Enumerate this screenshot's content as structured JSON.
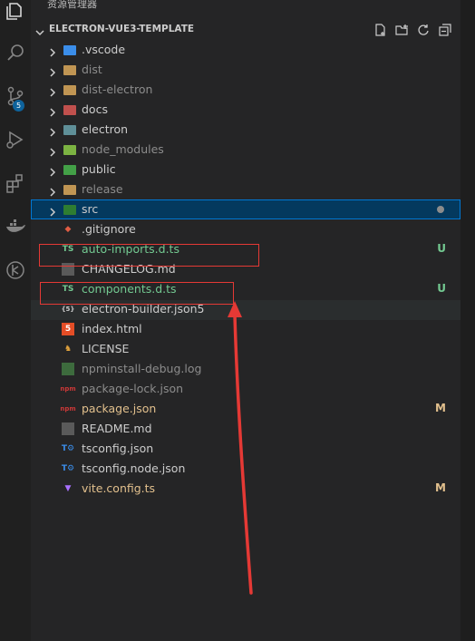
{
  "sidebar": {
    "title": "资源管理器",
    "more": "···"
  },
  "explorer": {
    "project": "ELECTRON-VUE3-TEMPLATE",
    "actions": [
      "new-file-icon",
      "new-folder-icon",
      "refresh-icon",
      "collapse-all-icon"
    ],
    "items": [
      {
        "name": ".vscode",
        "kind": "folder",
        "icon": "vscode-folder-icon",
        "color": "#cccccc"
      },
      {
        "name": "dist",
        "kind": "folder",
        "icon": "folder-icon",
        "color": "#8c8c8c"
      },
      {
        "name": "dist-electron",
        "kind": "folder",
        "icon": "folder-icon",
        "color": "#8c8c8c"
      },
      {
        "name": "docs",
        "kind": "folder",
        "icon": "docs-folder-icon",
        "color": "#cccccc"
      },
      {
        "name": "electron",
        "kind": "folder",
        "icon": "electron-folder-icon",
        "color": "#cccccc"
      },
      {
        "name": "node_modules",
        "kind": "folder",
        "icon": "node-folder-icon",
        "color": "#8c8c8c"
      },
      {
        "name": "public",
        "kind": "folder",
        "icon": "public-folder-icon",
        "color": "#cccccc"
      },
      {
        "name": "release",
        "kind": "folder",
        "icon": "folder-icon",
        "color": "#8c8c8c"
      },
      {
        "name": "src",
        "kind": "folder",
        "icon": "src-folder-icon",
        "color": "#cccccc",
        "selected": true,
        "modified_dot": true
      },
      {
        "name": ".gitignore",
        "kind": "file",
        "icon": "git-icon",
        "color": "#cccccc"
      },
      {
        "name": "auto-imports.d.ts",
        "kind": "file",
        "icon": "typescript-def-icon",
        "color": "#73c991",
        "status": "U"
      },
      {
        "name": "CHANGELOG.md",
        "kind": "file",
        "icon": "changelog-icon",
        "color": "#cccccc"
      },
      {
        "name": "components.d.ts",
        "kind": "file",
        "icon": "typescript-def-icon",
        "color": "#73c991",
        "status": "U"
      },
      {
        "name": "electron-builder.json5",
        "kind": "file",
        "icon": "json5-icon",
        "color": "#cccccc"
      },
      {
        "name": "index.html",
        "kind": "file",
        "icon": "html-icon",
        "color": "#cccccc"
      },
      {
        "name": "LICENSE",
        "kind": "file",
        "icon": "license-icon",
        "color": "#cccccc"
      },
      {
        "name": "npminstall-debug.log",
        "kind": "file",
        "icon": "log-icon",
        "color": "#8c8c8c"
      },
      {
        "name": "package-lock.json",
        "kind": "file",
        "icon": "npm-icon",
        "color": "#8c8c8c"
      },
      {
        "name": "package.json",
        "kind": "file",
        "icon": "npm-icon",
        "color": "#e2c08d",
        "status": "M"
      },
      {
        "name": "README.md",
        "kind": "file",
        "icon": "markdown-icon",
        "color": "#cccccc"
      },
      {
        "name": "tsconfig.json",
        "kind": "file",
        "icon": "tsconfig-icon",
        "color": "#cccccc"
      },
      {
        "name": "tsconfig.node.json",
        "kind": "file",
        "icon": "tsconfig-icon",
        "color": "#cccccc"
      },
      {
        "name": "vite.config.ts",
        "kind": "file",
        "icon": "vite-icon",
        "color": "#e2c08d",
        "status": "M"
      }
    ]
  },
  "activity": {
    "source_control_badge": "5"
  },
  "colors": {
    "untracked": "#73c991",
    "modified": "#e2c08d",
    "annotation": "#e53935"
  }
}
